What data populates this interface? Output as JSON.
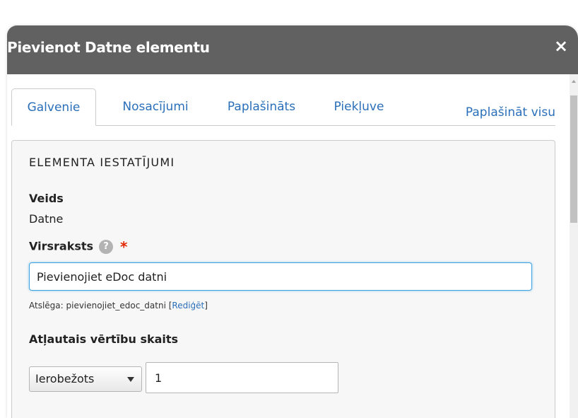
{
  "dialog": {
    "title": "Pievienot Datne elementu",
    "close_glyph": "×"
  },
  "tabs": [
    {
      "label": "Galvenie",
      "active": true
    },
    {
      "label": "Nosacījumi",
      "active": false
    },
    {
      "label": "Paplašināts",
      "active": false
    },
    {
      "label": "Piekļuve",
      "active": false
    }
  ],
  "expand_all_label": "Paplašināt visu",
  "panel": {
    "heading": "ELEMENTA IESTATĪJUMI",
    "type_label": "Veids",
    "type_value": "Datne",
    "title_label": "Virsraksts",
    "help_glyph": "?",
    "required_glyph": "*",
    "title_value": "Pievienojiet eDoc datni",
    "machine_name_prefix": "Atslēga: pievienojiet_edoc_datni [",
    "machine_name_edit": "Rediģēt",
    "machine_name_suffix": "]",
    "count_label": "Atļautais vērtību skaits",
    "count_select_value": "Ierobežots",
    "count_number_value": "1"
  },
  "colors": {
    "titlebar": "#616161",
    "link": "#2a6fba",
    "required": "#e32700",
    "focus": "#40a3e0"
  },
  "icons": {
    "close": "close-icon",
    "help": "help-icon",
    "required": "required-asterisk-icon",
    "select_arrow": "chevron-down-icon"
  }
}
